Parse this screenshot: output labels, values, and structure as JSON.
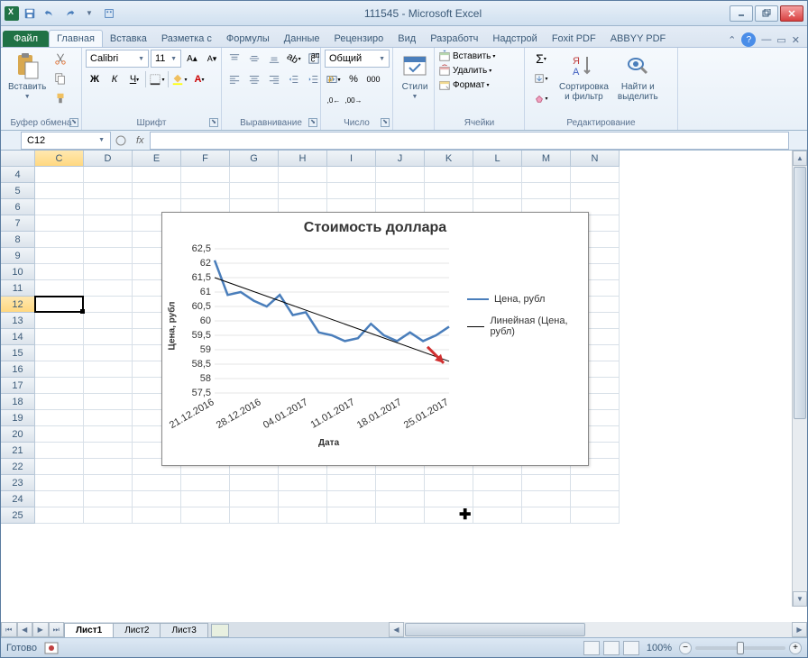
{
  "title": "111545 - Microsoft Excel",
  "file_tab": "Файл",
  "tabs": [
    "Главная",
    "Вставка",
    "Разметка с",
    "Формулы",
    "Данные",
    "Рецензиро",
    "Вид",
    "Разработч",
    "Надстрой",
    "Foxit PDF",
    "ABBYY PDF"
  ],
  "active_tab": 0,
  "ribbon": {
    "clipboard": {
      "label": "Буфер обмена",
      "paste": "Вставить"
    },
    "font": {
      "label": "Шрифт",
      "name": "Calibri",
      "size": "11"
    },
    "alignment": {
      "label": "Выравнивание"
    },
    "number": {
      "label": "Число",
      "format": "Общий"
    },
    "styles": {
      "label": "",
      "btn": "Стили"
    },
    "cells": {
      "label": "Ячейки",
      "insert": "Вставить",
      "delete": "Удалить",
      "format": "Формат"
    },
    "editing": {
      "label": "Редактирование",
      "sort": "Сортировка\nи фильтр",
      "find": "Найти и\nвыделить"
    }
  },
  "namebox": "C12",
  "columns": [
    "C",
    "D",
    "E",
    "F",
    "G",
    "H",
    "I",
    "J",
    "K",
    "L",
    "M",
    "N"
  ],
  "rows": [
    "4",
    "5",
    "6",
    "7",
    "8",
    "9",
    "10",
    "11",
    "12",
    "13",
    "14",
    "15",
    "16",
    "17",
    "18",
    "19",
    "20",
    "21",
    "22",
    "23",
    "24",
    "25"
  ],
  "selected_col": 0,
  "selected_row": 8,
  "chart_data": {
    "type": "line",
    "title": "Стоимость доллара",
    "xlabel": "Дата",
    "ylabel": "Цена, рубл",
    "categories": [
      "21.12.2016",
      "28.12.2016",
      "04.01.2017",
      "11.01.2017",
      "18.01.2017",
      "25.01.2017"
    ],
    "y_ticks": [
      57.5,
      58,
      58.5,
      59,
      59.5,
      60,
      60.5,
      61,
      61.5,
      62,
      62.5
    ],
    "ylim": [
      57.5,
      62.5
    ],
    "series": [
      {
        "name": "Цена, рубл",
        "color": "#4a7ebb",
        "values": [
          62.1,
          60.9,
          61.0,
          60.7,
          60.5,
          60.9,
          60.2,
          60.3,
          59.6,
          59.5,
          59.3,
          59.4,
          59.9,
          59.5,
          59.3,
          59.6,
          59.3,
          59.5,
          59.8
        ]
      },
      {
        "name": "Линейная (Цена, рубл)",
        "color": "#000",
        "values": [
          61.5,
          58.6
        ],
        "trendline": true
      }
    ]
  },
  "sheets": [
    "Лист1",
    "Лист2",
    "Лист3"
  ],
  "active_sheet": 0,
  "status": "Готово",
  "zoom": "100%"
}
